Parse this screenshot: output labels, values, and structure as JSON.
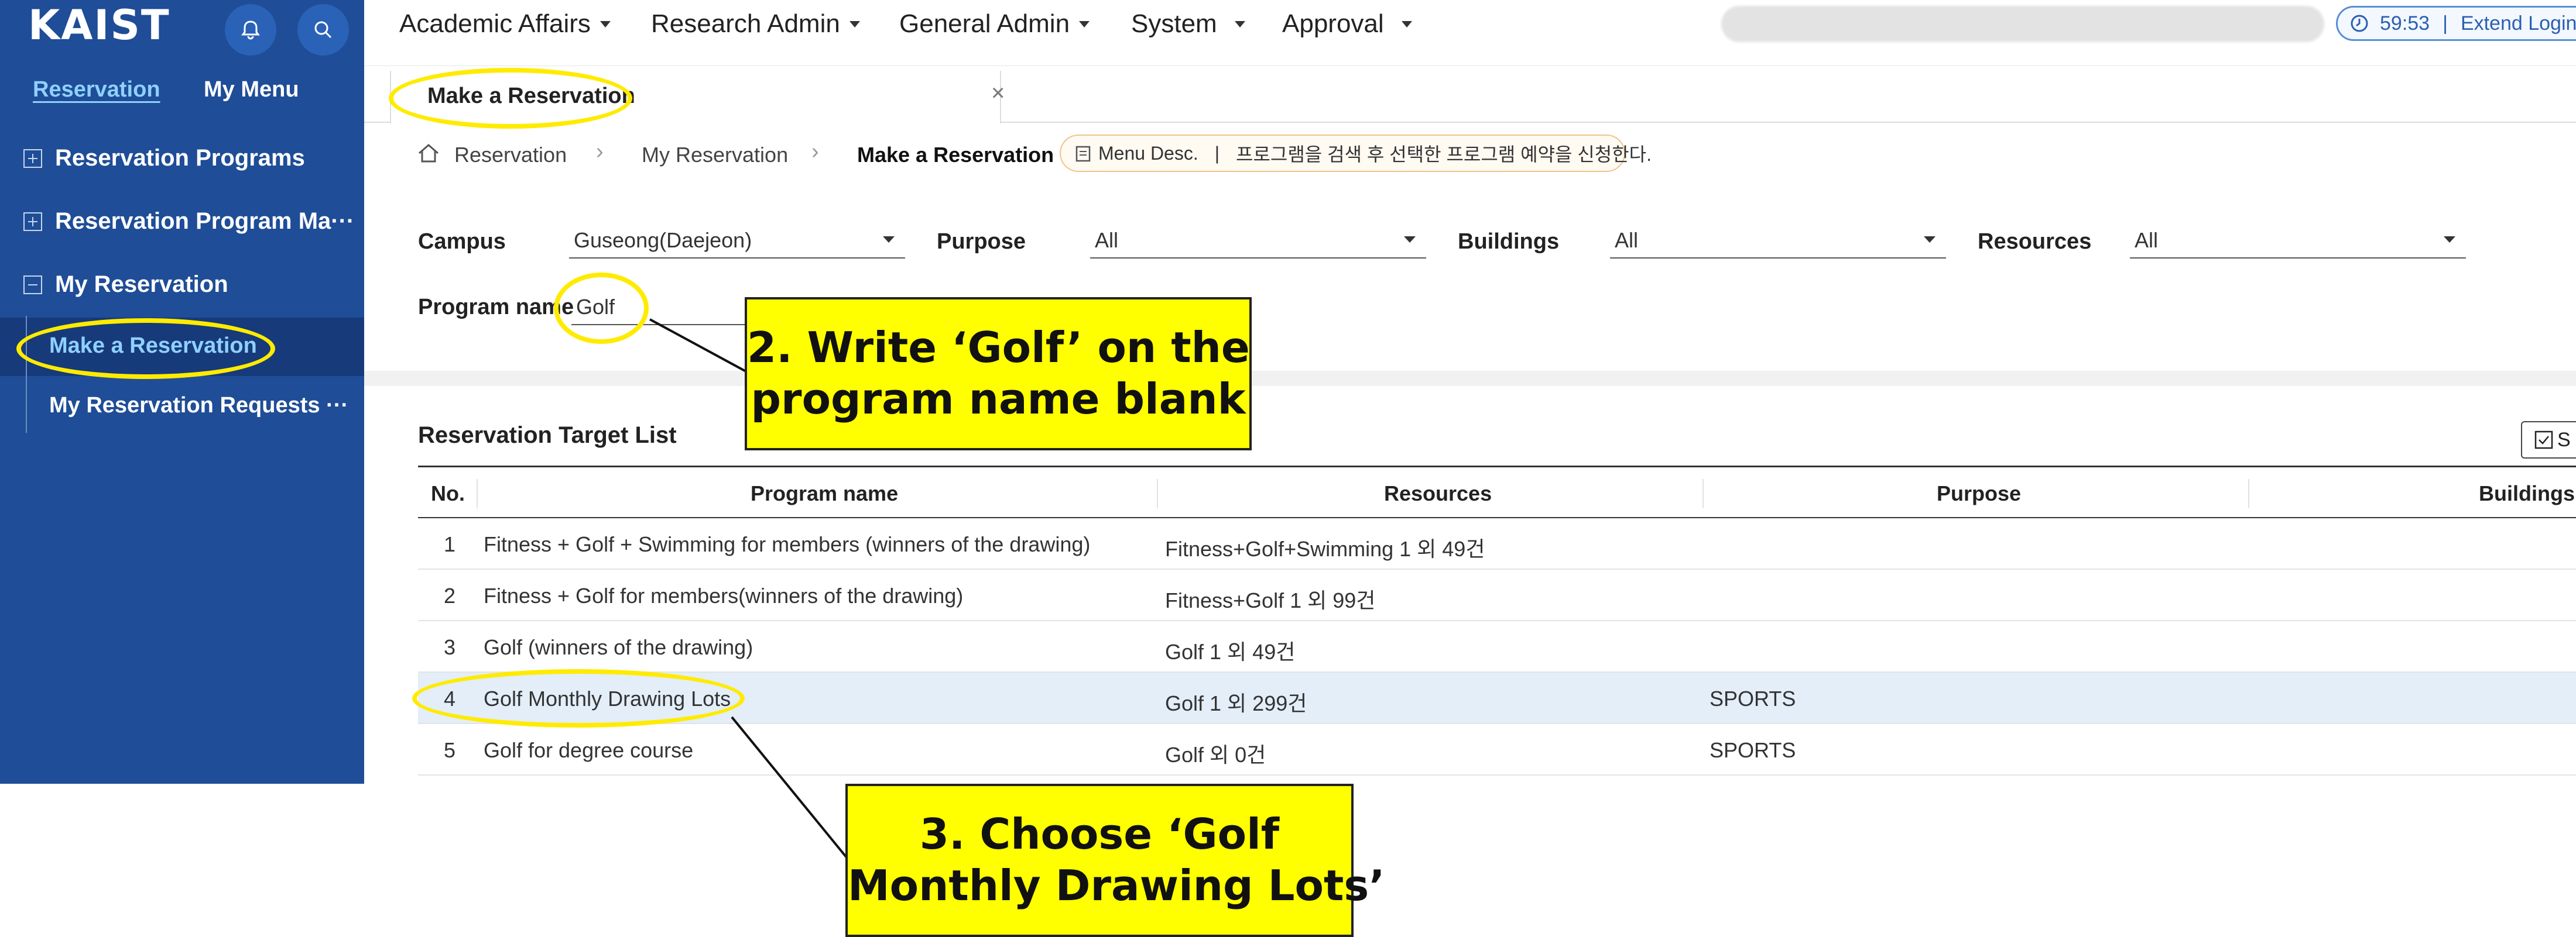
{
  "sidebar": {
    "logo": "KAIST",
    "tabs": {
      "active": "Reservation",
      "other": "My Menu"
    },
    "items": [
      {
        "label": "Reservation Programs",
        "icon": "plus-box-icon"
      },
      {
        "label": "Reservation Program Ma···",
        "icon": "plus-box-icon"
      },
      {
        "label": "My Reservation",
        "icon": "minus-box-icon"
      }
    ],
    "sub_items": [
      {
        "label": "Make a Reservation"
      },
      {
        "label": "My Reservation Requests ···"
      }
    ]
  },
  "topnav": {
    "items": [
      "Academic Affairs",
      "Research Admin",
      "General Admin",
      "System",
      "Approval"
    ],
    "timer": "59:53",
    "extend": "Extend Login"
  },
  "tab": {
    "title": "Make a Reservation",
    "close": "×"
  },
  "breadcrumb": {
    "items": [
      "Reservation",
      "My Reservation",
      "Make a Reservation"
    ],
    "desc_label": "Menu Desc.",
    "desc_text": "프로그램을 검색 후 선택한 프로그램 예약을 신청한다."
  },
  "filters": {
    "campus_label": "Campus",
    "campus_value": "Guseong(Daejeon)",
    "purpose_label": "Purpose",
    "purpose_value": "All",
    "buildings_label": "Buildings",
    "buildings_value": "All",
    "resources_label": "Resources",
    "resources_value": "All",
    "program_label": "Program name",
    "program_value": "Golf"
  },
  "list": {
    "title": "Reservation Target List",
    "select_button": "S",
    "columns": [
      "No.",
      "Program name",
      "Resources",
      "Purpose",
      "Buildings"
    ],
    "rows": [
      {
        "no": "1",
        "name": "Fitness + Golf + Swimming for members (winners of the drawing)",
        "resources": "Fitness+Golf+Swimming 1 외 49건",
        "purpose": ""
      },
      {
        "no": "2",
        "name": "Fitness + Golf for members(winners of the drawing)",
        "resources": "Fitness+Golf 1 외 99건",
        "purpose": ""
      },
      {
        "no": "3",
        "name": "Golf  (winners of the drawing)",
        "resources": "Golf 1 외 49건",
        "purpose": ""
      },
      {
        "no": "4",
        "name": "Golf Monthly Drawing Lots",
        "resources": "Golf 1 외 299건",
        "purpose": "SPORTS"
      },
      {
        "no": "5",
        "name": "Golf for degree course",
        "resources": "Golf 외 0건",
        "purpose": "SPORTS"
      }
    ]
  },
  "annotations": {
    "step2_line1": "2. Write ‘Golf’ on the",
    "step2_line2": "program name blank",
    "step3_line1": "3. Choose ‘Golf",
    "step3_line2": "Monthly Drawing Lots’",
    "highlight_color": "#ffeb00",
    "box_color": "#ffff00"
  },
  "colors": {
    "sidebar": "#1f4d97",
    "accent": "#8fd0ff",
    "selected_row": "#e3eef9"
  }
}
